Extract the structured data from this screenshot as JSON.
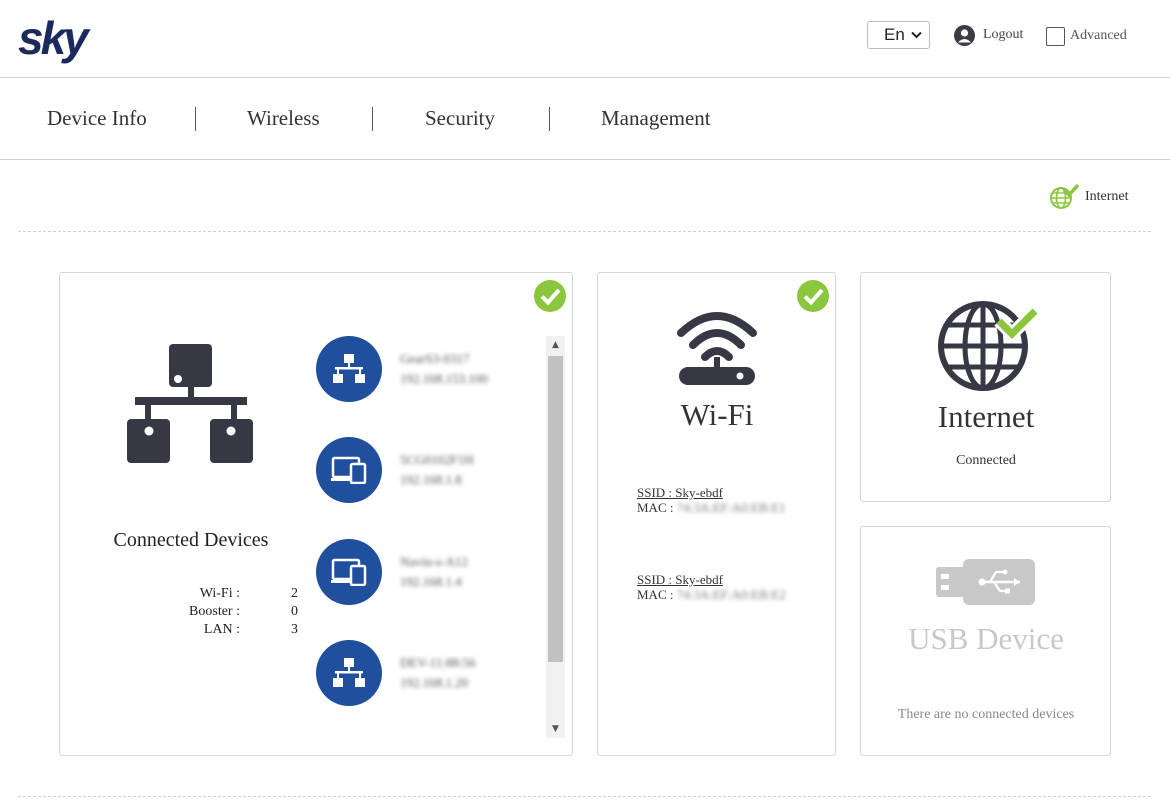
{
  "header": {
    "brand": "sky",
    "language": "En",
    "logout_label": "Logout",
    "advanced_label": "Advanced"
  },
  "nav": {
    "items": [
      "Device Info",
      "Wireless",
      "Security",
      "Management"
    ]
  },
  "status": {
    "internet_label": "Internet"
  },
  "connected_devices": {
    "title": "Connected Devices",
    "stats": [
      {
        "label": "Wi-Fi :",
        "value": "2"
      },
      {
        "label": "Booster :",
        "value": "0"
      },
      {
        "label": "LAN :",
        "value": "3"
      }
    ],
    "devices": [
      {
        "name": "GearS3-0317",
        "ip": "192.168.153.100",
        "icon": "network-icon"
      },
      {
        "name": "5CG0102F1H",
        "ip": "192.168.1.8",
        "icon": "devices-icon"
      },
      {
        "name": "Navin-s-A12",
        "ip": "192.168.1.4",
        "icon": "devices-icon"
      },
      {
        "name": "DEV-11:88:56",
        "ip": "192.168.1.20",
        "icon": "network-icon"
      }
    ]
  },
  "wifi": {
    "title": "Wi-Fi",
    "networks": [
      {
        "ssid": "SSID : Sky-ebdf",
        "mac_label": "MAC :",
        "mac": "74:3A:EF:A0:EB:E1"
      },
      {
        "ssid": "SSID : Sky-ebdf",
        "mac_label": "MAC :",
        "mac": "74:3A:EF:A0:EB:E2"
      }
    ]
  },
  "internet": {
    "title": "Internet",
    "status": "Connected"
  },
  "usb": {
    "title": "USB Device",
    "message": "There are no connected devices"
  },
  "colors": {
    "brand": "#1b2a5e",
    "device_circle": "#1f4f9d",
    "ok_green": "#8cc63f",
    "icon_dark": "#363944",
    "usb_grey": "#c8c8c8"
  }
}
